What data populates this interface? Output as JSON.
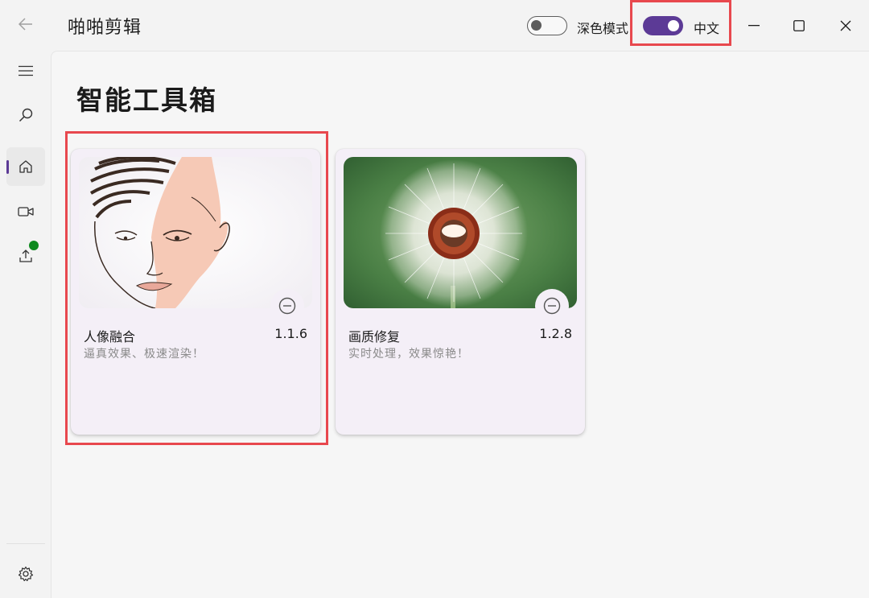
{
  "app": {
    "title": "啪啪剪辑"
  },
  "header": {
    "dark_mode": {
      "label": "深色模式",
      "enabled": false
    },
    "language": {
      "label": "中文",
      "enabled": true
    }
  },
  "sidebar": {
    "items": [
      {
        "icon": "menu-icon"
      },
      {
        "icon": "search-icon"
      },
      {
        "icon": "home-icon",
        "active": true
      },
      {
        "icon": "video-icon"
      },
      {
        "icon": "upload-icon",
        "badge": true
      },
      {
        "icon": "gear-icon"
      }
    ]
  },
  "main": {
    "title": "智能工具箱",
    "cards": [
      {
        "name": "人像融合",
        "version": "1.1.6",
        "description": "逼真效果、极速渲染！",
        "image": "face-illustration"
      },
      {
        "name": "画质修复",
        "version": "1.2.8",
        "description": "实时处理，效果惊艳！",
        "image": "dandelion-photo"
      }
    ]
  },
  "colors": {
    "accent": "#5c3a96",
    "highlight": "#e8484e",
    "badge": "#0f8a1f",
    "card_bg": "#f4eff7"
  }
}
